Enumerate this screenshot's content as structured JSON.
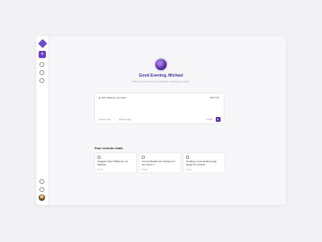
{
  "sidebar": {
    "new_chat_label": "+"
  },
  "hero": {
    "greeting": "Good Evening, Michael",
    "subtitle": "Write a simple prompt to generate anything you want !"
  },
  "prompt": {
    "placeholder": "Ask whatever you want",
    "model": "GPT-4 ▾",
    "attach_label": "Attach a file",
    "image_label": "Use Image",
    "char_count": "0/1000"
  },
  "recents": {
    "title": "Your recents chats",
    "items": [
      {
        "title": "Suggest Color Pallets for my Website",
        "time": "2h ago"
      },
      {
        "title": "Can AI Replace the Designer in the Future ?",
        "time": "5h ago"
      },
      {
        "title": "Creating a new landing page design for product",
        "time": "1d ago"
      }
    ]
  },
  "colors": {
    "accent": "#6a3fc0",
    "accent_dark": "#4a2d9a"
  }
}
